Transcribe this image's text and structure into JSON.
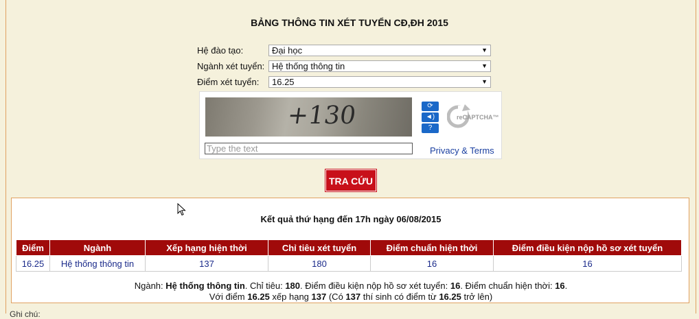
{
  "page": {
    "title": "BẢNG THÔNG TIN XÉT TUYỂN CĐ,ĐH 2015"
  },
  "form": {
    "he_dao_tao": {
      "label": "Hệ đào tạo:",
      "value": "Đại học"
    },
    "nganh": {
      "label": "Ngành xét tuyển:",
      "value": "Hệ thống thông tin"
    },
    "diem": {
      "label": "Điểm xét tuyển:",
      "value": "16.25"
    }
  },
  "captcha": {
    "image_text": "+130",
    "input_placeholder": "Type the text",
    "privacy_text": "Privacy & Terms",
    "logo_text": "reCAPTCHA™",
    "icons": [
      "refresh-icon",
      "audio-icon",
      "help-icon"
    ]
  },
  "search_button": "TRA CỨU",
  "result": {
    "title": "Kết quả thứ hạng đến 17h ngày 06/08/2015",
    "columns": [
      "Điểm",
      "Ngành",
      "Xếp hạng hiện thời",
      "Chỉ tiêu xét tuyển",
      "Điểm chuẩn hiện thời",
      "Điểm điều kiện nộp hồ sơ xét tuyển"
    ],
    "rows": [
      [
        "16.25",
        "Hệ thống thông tin",
        "137",
        "180",
        "16",
        "16"
      ]
    ],
    "summary_line1": {
      "p1": "Ngành: ",
      "b1": "Hệ thống thông tin",
      "p2": ". Chỉ tiêu: ",
      "b2": "180",
      "p3": ". Điểm điều kiện nộp hồ sơ xét tuyển: ",
      "b3": "16",
      "p4": ". Điểm chuẩn hiện thời: ",
      "b4": "16",
      "p5": "."
    },
    "summary_line2": {
      "p1": "Với điểm ",
      "b1": "16.25",
      "p2": " xếp hạng ",
      "b2": "137",
      "p3": " (Có ",
      "b3": "137",
      "p4": " thí sinh có điểm từ ",
      "b4": "16.25",
      "p5": " trở lên)"
    }
  },
  "footer": {
    "note": "Ghi chú:"
  },
  "colors": {
    "background": "#f5f1dc",
    "accent_red": "#c8101a",
    "header_red": "#a00a0a",
    "link_blue": "#1a3fa0"
  }
}
